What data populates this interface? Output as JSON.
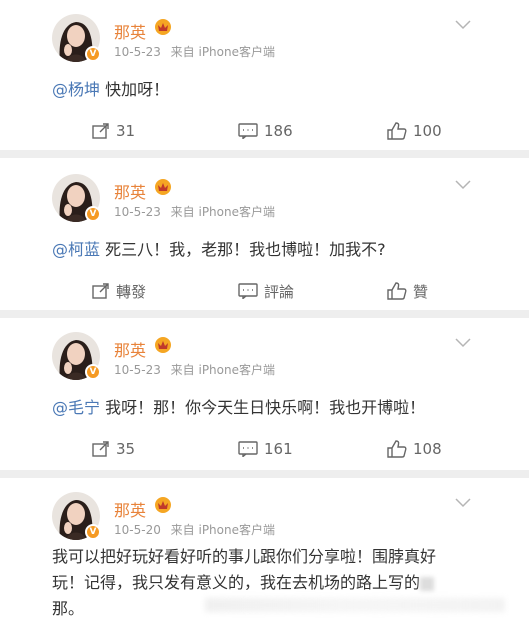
{
  "posts": [
    {
      "author": "那英",
      "date": "10-5-23",
      "source": "来自 iPhone客户端",
      "mention": "@杨坤",
      "text": " 快加呀！",
      "repost": "31",
      "comment": "186",
      "like": "100"
    },
    {
      "author": "那英",
      "date": "10-5-23",
      "source": "来自 iPhone客户端",
      "mention": "@柯蓝",
      "text": " 死三八！我，老那！我也博啦！加我不?",
      "repost": "轉發",
      "comment": "評論",
      "like": "贊"
    },
    {
      "author": "那英",
      "date": "10-5-23",
      "source": "来自 iPhone客户端",
      "mention": "@毛宁",
      "text": " 我呀！那！你今天生日快乐啊！我也开博啦！",
      "repost": "35",
      "comment": "161",
      "like": "108"
    },
    {
      "author": "那英",
      "date": "10-5-20",
      "source": "来自 iPhone客户端",
      "line1": "我可以把好玩好看好听的事儿跟你们分享啦！围脖真好",
      "line2": "玩！记得，我只发有意义的，我在去机场的路上写的",
      "line3": "那。"
    }
  ],
  "colors": {
    "name": "#e8833a",
    "mention": "#4a78b5",
    "meta": "#999999",
    "separator": "#eeeeee"
  }
}
